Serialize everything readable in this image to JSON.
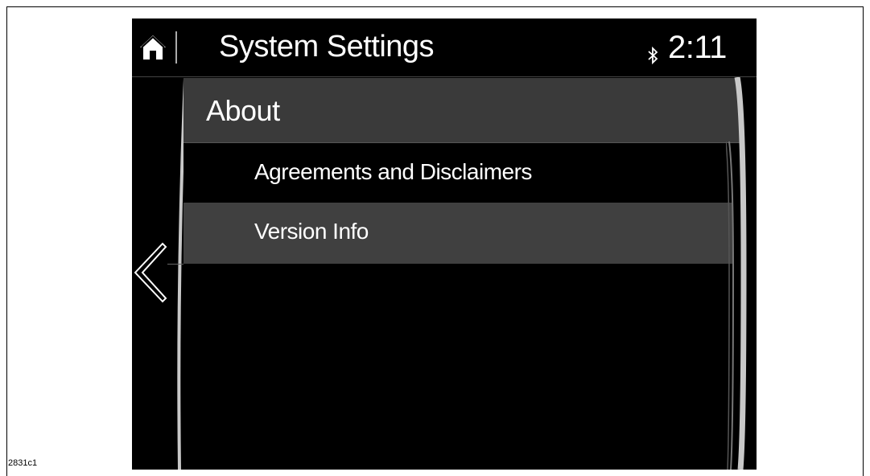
{
  "header": {
    "title": "System Settings",
    "time": "2:11",
    "home_icon": "home-icon",
    "bluetooth_icon": "bluetooth-icon"
  },
  "section": {
    "title": "About"
  },
  "menu": {
    "items": [
      {
        "label": "Agreements and Disclaimers",
        "selected": false
      },
      {
        "label": "Version Info",
        "selected": true
      }
    ]
  },
  "nav": {
    "back_icon": "chevron-left-icon"
  },
  "figure": {
    "id": "2831c1"
  },
  "colors": {
    "screen_bg": "#000000",
    "header_row_bg": "#3a3a3a",
    "selected_row_bg": "#404040",
    "text": "#ffffff",
    "rail": "#c8c8c8"
  }
}
